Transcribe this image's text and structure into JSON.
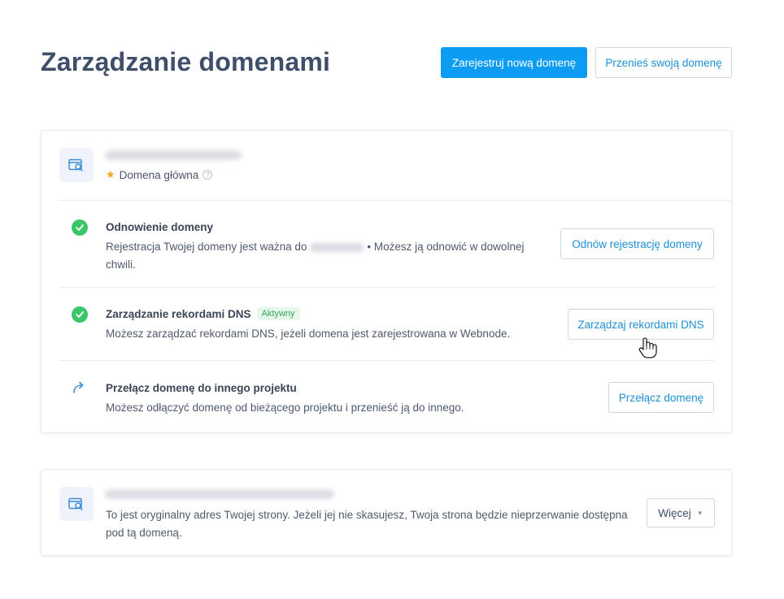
{
  "header": {
    "title": "Zarządzanie domenami",
    "register_button": "Zarejestruj nową domenę",
    "transfer_button": "Przenieś swoją domenę"
  },
  "primary_card": {
    "main_label": "Domena główna",
    "rows": [
      {
        "title": "Odnowienie domeny",
        "desc_before": "Rejestracja Twojej domeny jest ważna do",
        "desc_after": "• Możesz ją odnowić w dowolnej",
        "desc_line2": "chwili.",
        "button": "Odnów rejestrację domeny",
        "icon": "check-circle-icon"
      },
      {
        "title": "Zarządzanie rekordami DNS",
        "badge": "Aktywny",
        "desc": "Możesz zarządzać rekordami DNS, jeżeli domena jest zarejestrowana w Webnode.",
        "button": "Zarządzaj rekordami DNS",
        "icon": "check-circle-icon"
      },
      {
        "title": "Przełącz domenę do innego projektu",
        "desc": "Możesz odłączyć domenę od bieżącego projektu i przenieść ją do innego.",
        "button": "Przełącz domenę",
        "icon": "redirect-arrow-icon"
      }
    ]
  },
  "secondary_card": {
    "desc_line1": "To jest oryginalny adres Twojej strony. Jeżeli jej nie skasujesz, Twoja strona będzie nieprzerwanie dostępna",
    "desc_line2": "pod tą domeną.",
    "more_button": "Więcej"
  },
  "colors": {
    "primary": "#0c9cf3",
    "success": "#3bc46a",
    "title": "#3f4f6a",
    "star": "#f5a623"
  }
}
